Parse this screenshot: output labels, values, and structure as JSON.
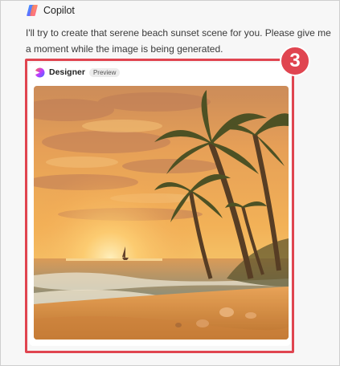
{
  "header": {
    "title": "Copilot",
    "icon": "copilot-logo-icon"
  },
  "message": {
    "text": "I'll try to create that serene beach sunset scene for you. Please give me a moment while the image is being generated."
  },
  "card": {
    "app_name": "Designer",
    "badge": "Preview",
    "icon": "designer-logo-icon",
    "image": {
      "subject": "beach sunset with palm trees",
      "type": "generated-image"
    }
  },
  "annotation": {
    "step_number": "3",
    "color": "#e04550"
  }
}
